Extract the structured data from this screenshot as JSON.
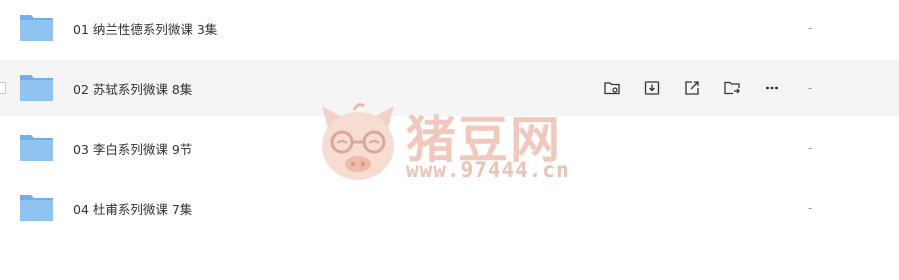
{
  "files": [
    {
      "name": "01 纳兰性德系列微课 3集",
      "size": "-"
    },
    {
      "name": "02 苏轼系列微课 8集",
      "size": "-"
    },
    {
      "name": "03 李白系列微课 9节",
      "size": "-"
    },
    {
      "name": "04 杜甫系列微课 7集",
      "size": "-"
    }
  ],
  "row_actions": [
    {
      "icon": "folder-location-icon"
    },
    {
      "icon": "download-icon"
    },
    {
      "icon": "share-icon"
    },
    {
      "icon": "move-to-folder-icon"
    },
    {
      "icon": "more-icon"
    }
  ],
  "watermark": {
    "title": "猪豆网",
    "url": "www.97444.cn"
  },
  "colors": {
    "folder": "#8fc4f2",
    "folder_dark": "#6fb0ea",
    "hover_row": "#f5f5f6",
    "watermark": "#f0c9bc"
  }
}
